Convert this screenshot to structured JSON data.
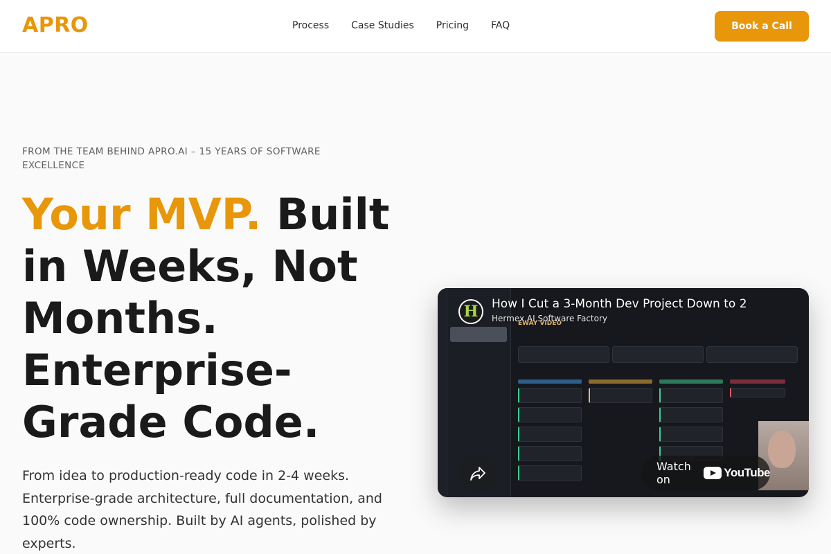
{
  "nav": {
    "logo": "APRO",
    "links": [
      "Process",
      "Case Studies",
      "Pricing",
      "FAQ"
    ],
    "cta": "Book a Call"
  },
  "hero": {
    "eyebrow": "FROM THE TEAM BEHIND APRO.AI – 15 YEARS OF SOFTWARE EXCELLENCE",
    "headline_accent": "Your MVP.",
    "headline_rest": " Built in Weeks, Not Months. Enterprise-Grade Code.",
    "subtext": "From idea to production-ready code in 2-4 weeks. Enterprise-grade architecture, full documentation, and 100% code ownership. Built by AI agents, polished by experts."
  },
  "video": {
    "title": "How I Cut a 3-Month Dev Project Down to 2",
    "channel": "Hermex AI Software Factory",
    "channel_initial": "H",
    "watch_on": "Watch on",
    "youtube": "YouTube",
    "board_title": "EWAY VIDEO"
  },
  "colors": {
    "accent": "#e8970a",
    "text": "#1a1a1a"
  },
  "icons": {
    "share": "share-arrow-icon",
    "youtube": "youtube-logo-icon"
  }
}
